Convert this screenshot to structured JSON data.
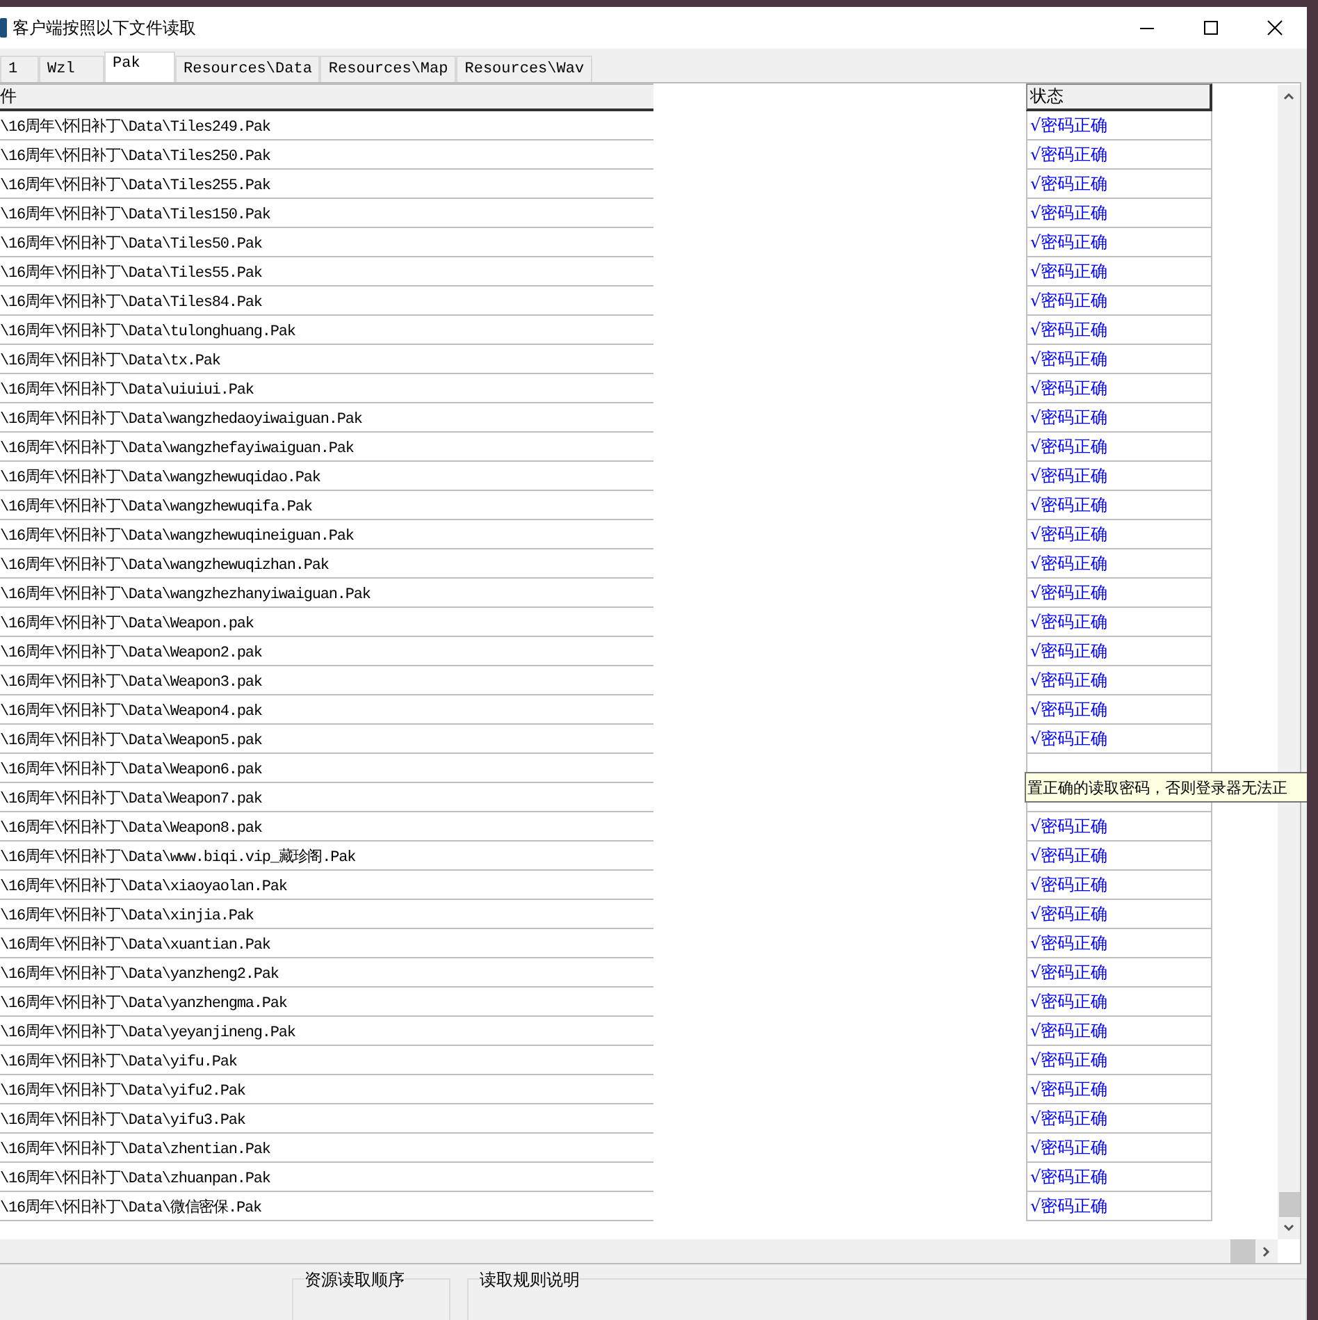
{
  "window": {
    "title": "客户端按照以下文件读取"
  },
  "tabs": [
    {
      "label": "1",
      "selected": false
    },
    {
      "label": "Wzl",
      "selected": false
    },
    {
      "label": "Pak",
      "selected": true
    },
    {
      "label": "Resources\\Data",
      "selected": false
    },
    {
      "label": "Resources\\Map",
      "selected": false
    },
    {
      "label": "Resources\\Wav",
      "selected": false
    }
  ],
  "table": {
    "columns": [
      "件",
      "状态"
    ],
    "rows": [
      {
        "file": "\\16周年\\怀旧补丁\\Data\\Tiles249.Pak",
        "status": "√密码正确"
      },
      {
        "file": "\\16周年\\怀旧补丁\\Data\\Tiles250.Pak",
        "status": "√密码正确"
      },
      {
        "file": "\\16周年\\怀旧补丁\\Data\\Tiles255.Pak",
        "status": "√密码正确"
      },
      {
        "file": "\\16周年\\怀旧补丁\\Data\\Tiles150.Pak",
        "status": "√密码正确"
      },
      {
        "file": "\\16周年\\怀旧补丁\\Data\\Tiles50.Pak",
        "status": "√密码正确"
      },
      {
        "file": "\\16周年\\怀旧补丁\\Data\\Tiles55.Pak",
        "status": "√密码正确"
      },
      {
        "file": "\\16周年\\怀旧补丁\\Data\\Tiles84.Pak",
        "status": "√密码正确"
      },
      {
        "file": "\\16周年\\怀旧补丁\\Data\\tulonghuang.Pak",
        "status": "√密码正确"
      },
      {
        "file": "\\16周年\\怀旧补丁\\Data\\tx.Pak",
        "status": "√密码正确"
      },
      {
        "file": "\\16周年\\怀旧补丁\\Data\\uiuiui.Pak",
        "status": "√密码正确"
      },
      {
        "file": "\\16周年\\怀旧补丁\\Data\\wangzhedaoyiwaiguan.Pak",
        "status": "√密码正确"
      },
      {
        "file": "\\16周年\\怀旧补丁\\Data\\wangzhefayiwaiguan.Pak",
        "status": "√密码正确"
      },
      {
        "file": "\\16周年\\怀旧补丁\\Data\\wangzhewuqidao.Pak",
        "status": "√密码正确"
      },
      {
        "file": "\\16周年\\怀旧补丁\\Data\\wangzhewuqifa.Pak",
        "status": "√密码正确"
      },
      {
        "file": "\\16周年\\怀旧补丁\\Data\\wangzhewuqineiguan.Pak",
        "status": "√密码正确"
      },
      {
        "file": "\\16周年\\怀旧补丁\\Data\\wangzhewuqizhan.Pak",
        "status": "√密码正确"
      },
      {
        "file": "\\16周年\\怀旧补丁\\Data\\wangzhezhanyiwaiguan.Pak",
        "status": "√密码正确"
      },
      {
        "file": "\\16周年\\怀旧补丁\\Data\\Weapon.pak",
        "status": "√密码正确"
      },
      {
        "file": "\\16周年\\怀旧补丁\\Data\\Weapon2.pak",
        "status": "√密码正确"
      },
      {
        "file": "\\16周年\\怀旧补丁\\Data\\Weapon3.pak",
        "status": "√密码正确"
      },
      {
        "file": "\\16周年\\怀旧补丁\\Data\\Weapon4.pak",
        "status": "√密码正确"
      },
      {
        "file": "\\16周年\\怀旧补丁\\Data\\Weapon5.pak",
        "status": "√密码正确"
      },
      {
        "file": "\\16周年\\怀旧补丁\\Data\\Weapon6.pak"
      },
      {
        "file": "\\16周年\\怀旧补丁\\Data\\Weapon7.pak"
      },
      {
        "file": "\\16周年\\怀旧补丁\\Data\\Weapon8.pak",
        "status": "√密码正确"
      },
      {
        "file": "\\16周年\\怀旧补丁\\Data\\www.biqi.vip_藏珍阁.Pak",
        "status": "√密码正确"
      },
      {
        "file": "\\16周年\\怀旧补丁\\Data\\xiaoyaolan.Pak",
        "status": "√密码正确"
      },
      {
        "file": "\\16周年\\怀旧补丁\\Data\\xinjia.Pak",
        "status": "√密码正确"
      },
      {
        "file": "\\16周年\\怀旧补丁\\Data\\xuantian.Pak",
        "status": "√密码正确"
      },
      {
        "file": "\\16周年\\怀旧补丁\\Data\\yanzheng2.Pak",
        "status": "√密码正确"
      },
      {
        "file": "\\16周年\\怀旧补丁\\Data\\yanzhengma.Pak",
        "status": "√密码正确"
      },
      {
        "file": "\\16周年\\怀旧补丁\\Data\\yeyanjineng.Pak",
        "status": "√密码正确"
      },
      {
        "file": "\\16周年\\怀旧补丁\\Data\\yifu.Pak",
        "status": "√密码正确"
      },
      {
        "file": "\\16周年\\怀旧补丁\\Data\\yifu2.Pak",
        "status": "√密码正确"
      },
      {
        "file": "\\16周年\\怀旧补丁\\Data\\yifu3.Pak",
        "status": "√密码正确"
      },
      {
        "file": "\\16周年\\怀旧补丁\\Data\\zhentian.Pak",
        "status": "√密码正确"
      },
      {
        "file": "\\16周年\\怀旧补丁\\Data\\zhuanpan.Pak",
        "status": "√密码正确"
      },
      {
        "file": "\\16周年\\怀旧补丁\\Data\\微信密保.Pak",
        "status": "√密码正确"
      }
    ]
  },
  "tooltip": {
    "text": "置正确的读取密码，否则登录器无法正"
  },
  "bottom_groups": [
    "资源读取顺序",
    "读取规则说明"
  ]
}
